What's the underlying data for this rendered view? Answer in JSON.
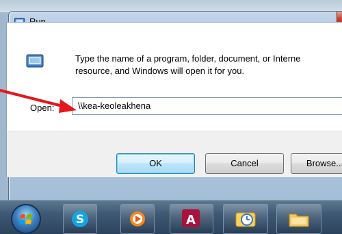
{
  "window": {
    "title": "Run",
    "description": "Type the name of a program, folder, document, or Internet resource, and Windows will open it for you.",
    "description_line1": "Type the name of a program, folder, document, or Interne",
    "description_line2": "resource, and Windows will open it for you.",
    "open_label_prefix": "Open:",
    "open_value": "\\\\kea-keoleakhena"
  },
  "buttons": {
    "ok": "OK",
    "cancel": "Cancel",
    "browse": "Browse..."
  },
  "annotation": {
    "arrow_color": "#e3171c"
  },
  "taskbar": {
    "items": [
      {
        "name": "start-orb",
        "icon": "windows-logo-icon"
      },
      {
        "name": "skype",
        "icon": "skype-icon"
      },
      {
        "name": "media",
        "icon": "media-player-icon"
      },
      {
        "name": "access",
        "icon": "access-icon"
      },
      {
        "name": "outlook",
        "icon": "outlook-icon"
      },
      {
        "name": "explorer",
        "icon": "folder-icon"
      }
    ]
  }
}
